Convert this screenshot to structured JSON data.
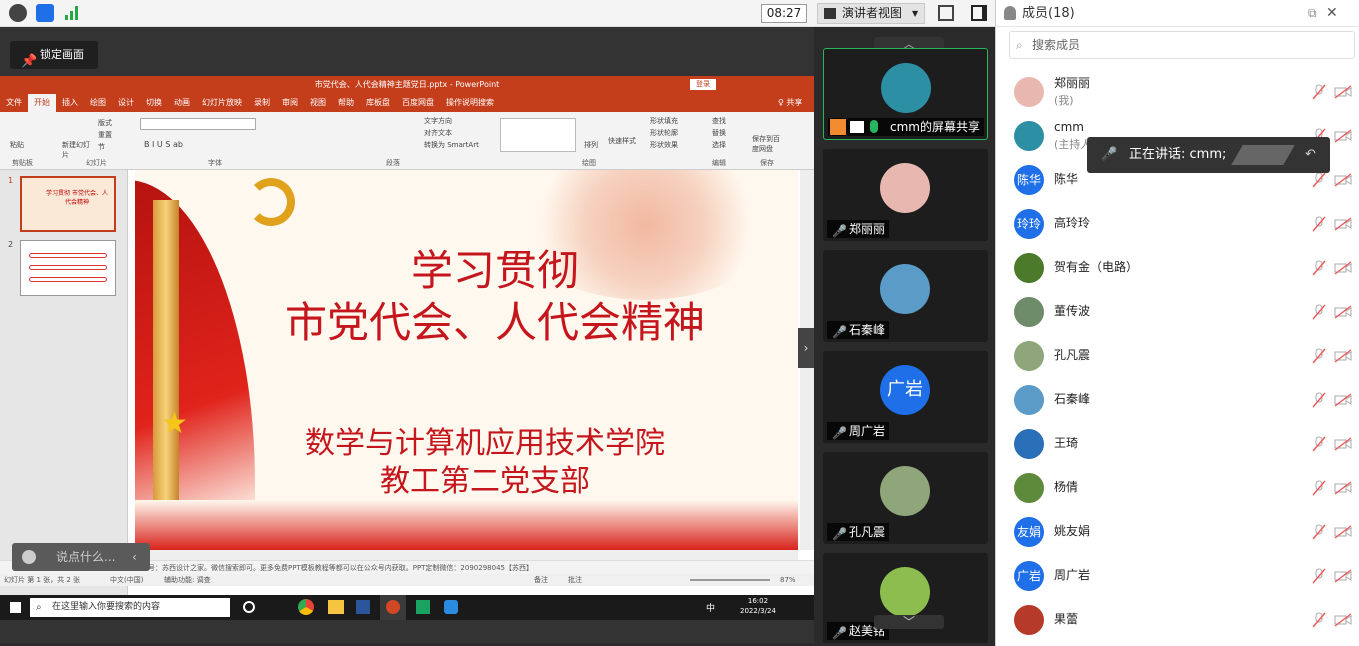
{
  "toolbar": {
    "time": "08:27",
    "presenter_view": "演讲者视图"
  },
  "stage": {
    "lock_label": "锁定画面",
    "chat_placeholder": "说点什么..."
  },
  "ppt": {
    "window_title": "市党代会、人代会精神主题党日.pptx - PowerPoint",
    "login": "登录",
    "share": "♀ 共享",
    "tabs": [
      "文件",
      "开始",
      "插入",
      "绘图",
      "设计",
      "切换",
      "动画",
      "幻灯片放映",
      "录制",
      "审阅",
      "视图",
      "帮助",
      "库板盘",
      "百度网盘",
      "操作说明搜索"
    ],
    "ribbon_groups": [
      "剪贴板",
      "幻灯片",
      "字体",
      "段落",
      "绘图",
      "编辑",
      "保存"
    ],
    "ribbon_items": {
      "paste": "粘贴",
      "new_slide": "新建幻灯片",
      "layout": "版式",
      "reset": "重置",
      "section": "节",
      "text_dir": "文字方向",
      "align": "对齐文本",
      "smartart": "转换为 SmartArt",
      "arrange": "排列",
      "quick_styles": "快速样式",
      "shape_fill": "形状填充",
      "shape_outline": "形状轮廓",
      "shape_effect": "形状效果",
      "find": "查找",
      "replace": "替换",
      "select": "选择",
      "save_baidu": "保存到百度网盘"
    },
    "slide": {
      "line1": "学习贯彻",
      "line2": "市党代会、人代会精神",
      "line3": "数学与计算机应用技术学院",
      "line4": "教工第二党支部"
    },
    "notes": "公众号：苏西设计之家。微信搜索即可。更多免费PPT模板教程等都可以在公众号内获取。PPT定制微信：2090298045【苏西】",
    "status": {
      "slide_count": "幻灯片 第 1 张，共 2 张",
      "lang": "中文(中国)",
      "accessibility": "辅助功能: 调查",
      "notes_btn": "备注",
      "comments_btn": "批注",
      "zoom": "87%"
    },
    "thumbs": [
      "1",
      "2"
    ],
    "thumb1_text": "学习贯彻 市党代会、人代会精神"
  },
  "taskbar": {
    "search": "在这里输入你要搜索的内容",
    "time": "16:02",
    "date": "2022/3/24",
    "ime": "中"
  },
  "tiles": [
    {
      "name": "cmm的屏幕共享",
      "color": "#2c8fa3"
    },
    {
      "name": "郑丽丽",
      "color": "#e8b7b0"
    },
    {
      "name": "石秦峰",
      "color": "#5a9bc7"
    },
    {
      "name": "周广岩",
      "avatar_text": "广岩",
      "color": "#1e6fe8"
    },
    {
      "name": "孔凡震",
      "color": "#8fa57a"
    },
    {
      "name": "赵美铭",
      "color": "#8dbd4f"
    }
  ],
  "panel": {
    "title": "成员(18)",
    "search_placeholder": "搜索成员",
    "speaking": "正在讲话: cmm;"
  },
  "members": [
    {
      "name": "郑丽丽",
      "role": "(我)",
      "color": "#e8b7b0",
      "text": ""
    },
    {
      "name": "cmm",
      "role": "(主持人)",
      "color": "#2c8fa3",
      "text": ""
    },
    {
      "name": "陈华",
      "role": "",
      "color": "#1e6fe8",
      "text": "陈华"
    },
    {
      "name": "高玲玲",
      "role": "",
      "color": "#1e6fe8",
      "text": "玲玲"
    },
    {
      "name": "贺有金（电路）",
      "role": "",
      "color": "#4a7a2a",
      "text": ""
    },
    {
      "name": "董传波",
      "role": "",
      "color": "#6e8c6a",
      "text": ""
    },
    {
      "name": "孔凡震",
      "role": "",
      "color": "#8fa57a",
      "text": ""
    },
    {
      "name": "石秦峰",
      "role": "",
      "color": "#5a9bc7",
      "text": ""
    },
    {
      "name": "王琦",
      "role": "",
      "color": "#2a6fb8",
      "text": ""
    },
    {
      "name": "杨倩",
      "role": "",
      "color": "#5e8a3c",
      "text": ""
    },
    {
      "name": "姚友娟",
      "role": "",
      "color": "#1e6fe8",
      "text": "友娟"
    },
    {
      "name": "周广岩",
      "role": "",
      "color": "#1e6fe8",
      "text": "广岩"
    },
    {
      "name": "果蕾",
      "role": "",
      "color": "#b53a2a",
      "text": ""
    }
  ]
}
